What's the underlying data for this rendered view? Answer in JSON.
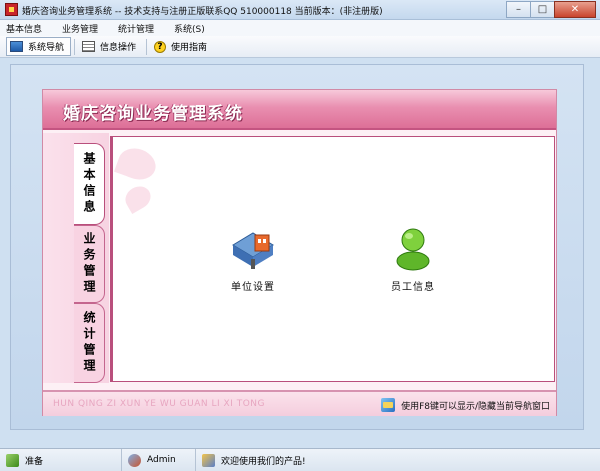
{
  "window": {
    "title": "婚庆咨询业务管理系统 -- 技术支持与注册正版联系QQ 510000118    当前版本：(非注册版)",
    "minimize_glyph": "–",
    "maximize_glyph": "□",
    "close_glyph": "✕"
  },
  "menu": [
    "基本信息",
    "业务管理",
    "统计管理",
    "系统(S)"
  ],
  "toolbar": {
    "nav_label": "系统导航",
    "info_label": "信息操作",
    "help_label": "使用指南",
    "help_glyph": "?"
  },
  "panel": {
    "title": "婚庆咨询业务管理系统",
    "tabs": [
      "基本信息",
      "业务管理",
      "统计管理"
    ],
    "active_tab": "基本信息",
    "items": [
      {
        "label": "单位设置",
        "icon": "building-icon"
      },
      {
        "label": "员工信息",
        "icon": "person-icon"
      }
    ],
    "footer_pinyin": "HUN QING ZI XUN YE WU GUAN LI XI TONG",
    "footer_hint": "使用F8键可以显示/隐藏当前导航窗口"
  },
  "status": {
    "ready": "准备",
    "user": "Admin",
    "welcome": "欢迎使用我们的产品!"
  },
  "colors": {
    "accent_pink": "#dd6f97",
    "tab_border": "#b94f7c",
    "window_bg": "#cfe0f1"
  }
}
